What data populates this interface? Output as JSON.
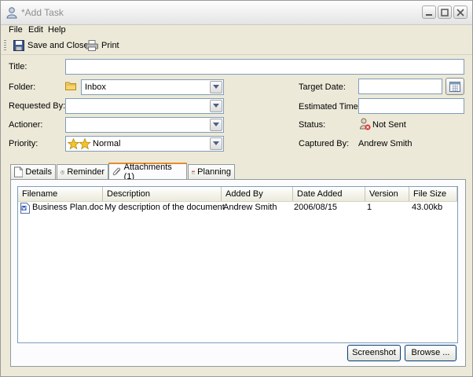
{
  "window": {
    "title": "*Add Task"
  },
  "menu": [
    "File",
    "Edit",
    "Help"
  ],
  "toolbar": {
    "save_close_label": "Save and Close",
    "print_label": "Print"
  },
  "form": {
    "title_label": "Title:",
    "title_value": "",
    "folder_label": "Folder:",
    "folder_value": "Inbox",
    "requested_by_label": "Requested By:",
    "requested_by_value": "",
    "actioner_label": "Actioner:",
    "actioner_value": "",
    "priority_label": "Priority:",
    "priority_value": "Normal",
    "target_date_label": "Target Date:",
    "target_date_value": "",
    "estimated_time_label": "Estimated Time:",
    "estimated_time_value": "",
    "status_label": "Status:",
    "status_value": "Not Sent",
    "captured_by_label": "Captured By:",
    "captured_by_value": "Andrew Smith"
  },
  "tabs": [
    {
      "label": "Details",
      "icon": "page-icon"
    },
    {
      "label": "Reminder",
      "icon": "clock-icon"
    },
    {
      "label": "Attachments (1)",
      "icon": "paperclip-icon",
      "active": true
    },
    {
      "label": "Planning",
      "icon": "calendar-icon"
    }
  ],
  "attachments": {
    "columns": [
      "Filename",
      "Description",
      "Added By",
      "Date Added",
      "Version",
      "File Size"
    ],
    "rows": [
      {
        "filename": "Business Plan.doc",
        "description": "My description of the document",
        "added_by": "Andrew Smith",
        "date_added": "2006/08/15",
        "version": "1",
        "file_size": "43.00kb"
      }
    ],
    "screenshot_label": "Screenshot",
    "browse_label": "Browse ..."
  },
  "colors": {
    "window_bg": "#ece9d8",
    "field_border": "#7f9db9",
    "tab_highlight": "#e68b2c"
  }
}
